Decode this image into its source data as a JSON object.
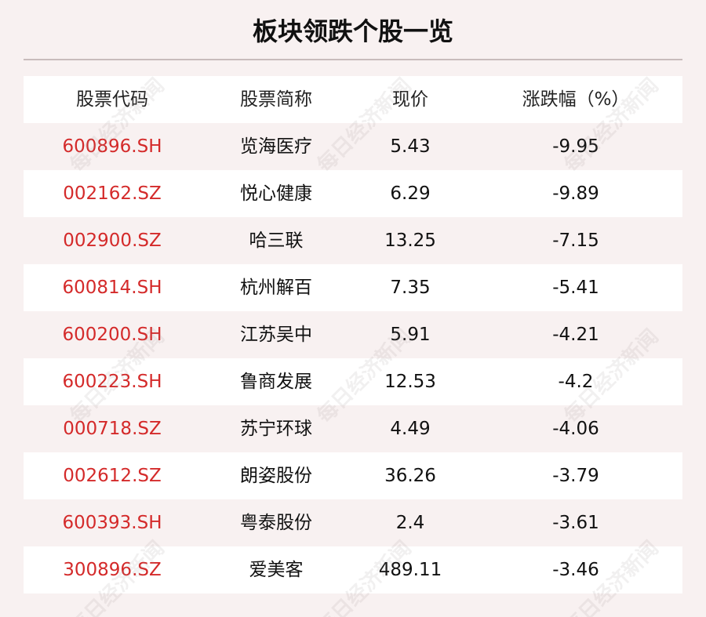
{
  "title": "板块领跌个股一览",
  "watermark": "每日经济新闻",
  "table": {
    "headers": [
      "股票代码",
      "股票简称",
      "现价",
      "涨跌幅（%）"
    ],
    "rows": [
      {
        "code": "600896.SH",
        "name": "览海医疗",
        "price": "5.43",
        "change": "-9.95"
      },
      {
        "code": "002162.SZ",
        "name": "悦心健康",
        "price": "6.29",
        "change": "-9.89"
      },
      {
        "code": "002900.SZ",
        "name": "哈三联",
        "price": "13.25",
        "change": "-7.15"
      },
      {
        "code": "600814.SH",
        "name": "杭州解百",
        "price": "7.35",
        "change": "-5.41"
      },
      {
        "code": "600200.SH",
        "name": "江苏吴中",
        "price": "5.91",
        "change": "-4.21"
      },
      {
        "code": "600223.SH",
        "name": "鲁商发展",
        "price": "12.53",
        "change": "-4.2"
      },
      {
        "code": "000718.SZ",
        "name": "苏宁环球",
        "price": "4.49",
        "change": "-4.06"
      },
      {
        "code": "002612.SZ",
        "name": "朗姿股份",
        "price": "36.26",
        "change": "-3.79"
      },
      {
        "code": "600393.SH",
        "name": "粤泰股份",
        "price": "2.4",
        "change": "-3.61"
      },
      {
        "code": "300896.SZ",
        "name": "爱美客",
        "price": "489.11",
        "change": "-3.46"
      }
    ]
  },
  "colors": {
    "code_text": "#d42a2a",
    "background": "#f8f1f1",
    "row_alt": "#ffffff"
  }
}
